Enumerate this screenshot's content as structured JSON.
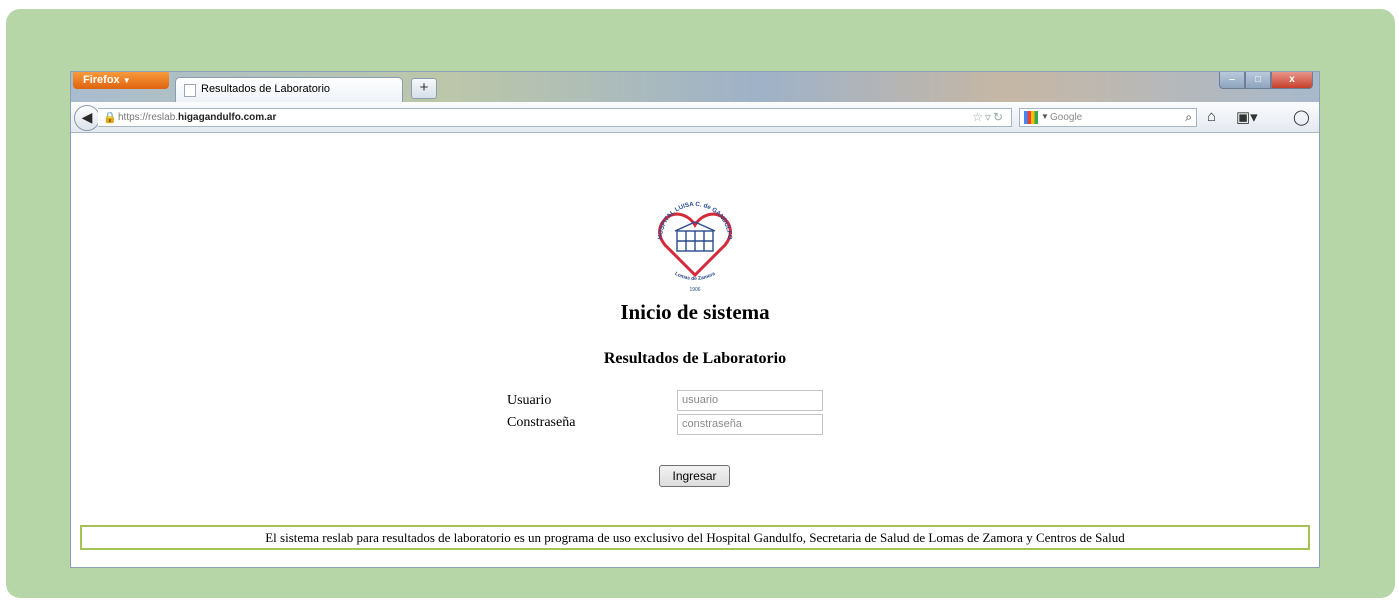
{
  "browser": {
    "menu_button_label": "Firefox",
    "tab_title": "Resultados de Laboratorio",
    "new_tab_label": "+",
    "window_controls": {
      "minimize": "–",
      "maximize": "□",
      "close": "x"
    },
    "url_prefix": "https://reslab.",
    "url_domain": "higagandulfo.com.ar",
    "search_placeholder": "Google",
    "icons": [
      "back-arrow-icon",
      "lock-icon",
      "bookmark-star-icon",
      "reload-icon",
      "search-engine-icon",
      "magnifier-icon",
      "home-icon",
      "downloads-icon",
      "addon-icon"
    ]
  },
  "logo": {
    "top_text": "HOSPITAL LUISA C. de GANDULFO",
    "bottom_text": "Lomas de Zamora",
    "year": "1906",
    "colors": {
      "heart": "#d42a3a",
      "building": "#2a4a8c"
    }
  },
  "page": {
    "heading": "Inicio de sistema",
    "subheading": "Resultados de Laboratorio",
    "user_label": "Usuario",
    "user_placeholder": "usuario",
    "password_label": "Constraseña",
    "password_placeholder": "constraseña",
    "submit_label": "Ingresar",
    "footer_text": "El sistema reslab para resultados de laboratorio es un programa de uso exclusivo del Hospital Gandulfo, Secretaria de Salud de Lomas de Zamora y Centros de Salud"
  },
  "colors": {
    "frame_background": "#b6d6a8",
    "footer_border": "#a5c256",
    "firefox_button": "#e8731f"
  }
}
